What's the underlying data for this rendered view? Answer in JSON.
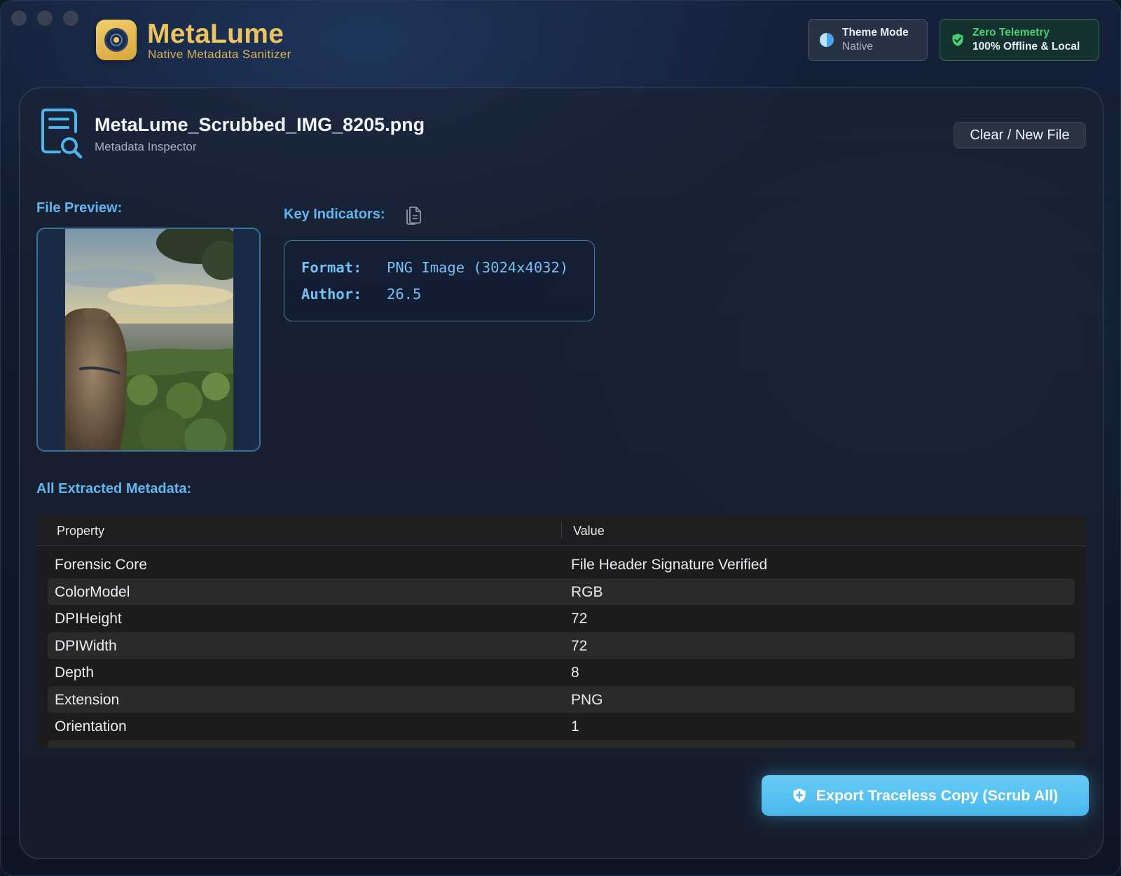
{
  "app": {
    "title": "MetaLume",
    "subtitle": "Native Metadata Sanitizer",
    "accent_color": "#ecc45d"
  },
  "header": {
    "theme_pill": {
      "title": "Theme Mode",
      "value": "Native",
      "icon": "half-circle-icon"
    },
    "telemetry_pill": {
      "title": "Zero Telemetry",
      "value": "100% Offline & Local",
      "icon": "shield-check-icon",
      "color": "#46d16e"
    }
  },
  "file": {
    "name": "MetaLume_Scrubbed_IMG_8205.png",
    "subtitle": "Metadata Inspector",
    "icon": "document-search-icon",
    "clear_button": "Clear / New File"
  },
  "preview": {
    "label": "File Preview:",
    "image_description": "dog-overlooking-valley-photo"
  },
  "indicators": {
    "label": "Key Indicators:",
    "copy_icon": "copy-icon",
    "rows": [
      {
        "key": "Format:",
        "value": "PNG Image (3024x4032)"
      },
      {
        "key": "Author:",
        "value": "26.5"
      }
    ],
    "color": "#77c0f2"
  },
  "metadata": {
    "label": "All Extracted Metadata:",
    "columns": [
      "Property",
      "Value"
    ],
    "rows": [
      {
        "property": "Forensic Core",
        "value": "File Header Signature Verified"
      },
      {
        "property": "ColorModel",
        "value": "RGB"
      },
      {
        "property": "DPIHeight",
        "value": "72"
      },
      {
        "property": "DPIWidth",
        "value": "72"
      },
      {
        "property": "Depth",
        "value": "8"
      },
      {
        "property": "Extension",
        "value": "PNG"
      },
      {
        "property": "Orientation",
        "value": "1"
      }
    ]
  },
  "export_button": {
    "label": "Export Traceless Copy (Scrub All)",
    "icon": "shield-icon",
    "color": "#4bb8ec"
  }
}
